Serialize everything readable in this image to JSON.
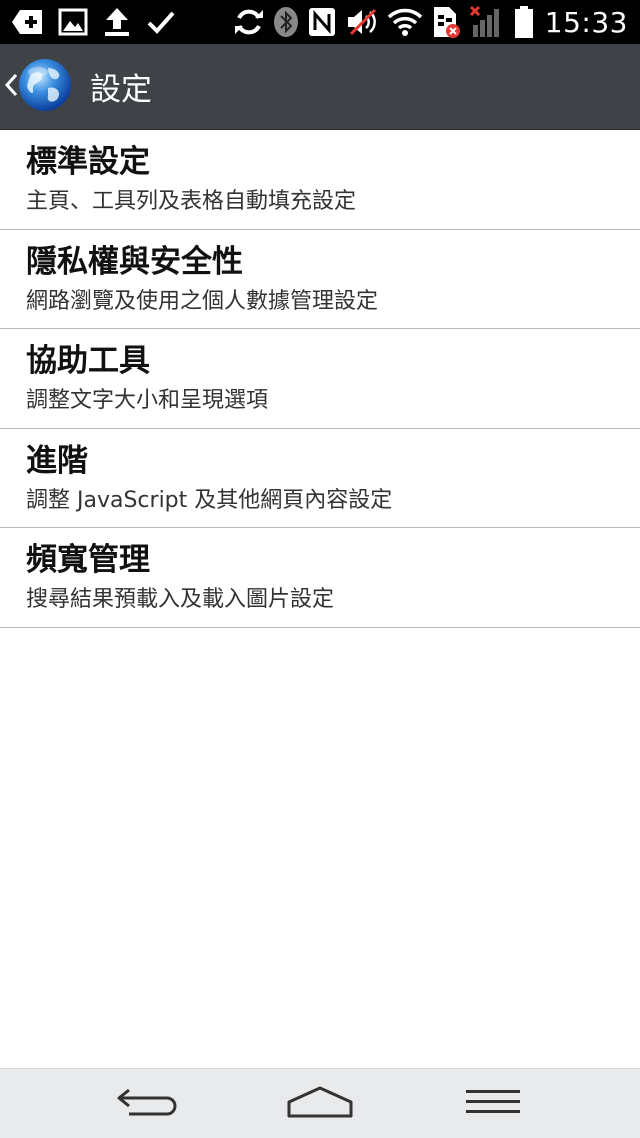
{
  "status_bar": {
    "time": "15:33",
    "icons_left": [
      "add-box-icon",
      "image-icon",
      "upload-icon",
      "check-icon"
    ],
    "icons_right": [
      "sync-icon",
      "bluetooth-icon",
      "nfc-icon",
      "mute-icon",
      "wifi-icon",
      "sim-error-icon",
      "signal-icon",
      "battery-icon"
    ]
  },
  "action_bar": {
    "title": "設定",
    "icon": "browser-globe-icon"
  },
  "settings": {
    "items": [
      {
        "title": "標準設定",
        "summary": "主頁、工具列及表格自動填充設定"
      },
      {
        "title": "隱私權與安全性",
        "summary": "網路瀏覽及使用之個人數據管理設定"
      },
      {
        "title": "協助工具",
        "summary": "調整文字大小和呈現選項"
      },
      {
        "title": "進階",
        "summary": "調整 JavaScript 及其他網頁內容設定"
      },
      {
        "title": "頻寬管理",
        "summary": "搜尋結果預載入及載入圖片設定"
      }
    ]
  },
  "nav_bar": {
    "buttons": [
      "back-icon",
      "home-icon",
      "menu-icon"
    ]
  },
  "colors": {
    "status_bar_bg": "#000000",
    "action_bar_bg": "#3f4246",
    "divider": "#b8b8b8",
    "nav_bar_bg": "#e8eaec"
  }
}
